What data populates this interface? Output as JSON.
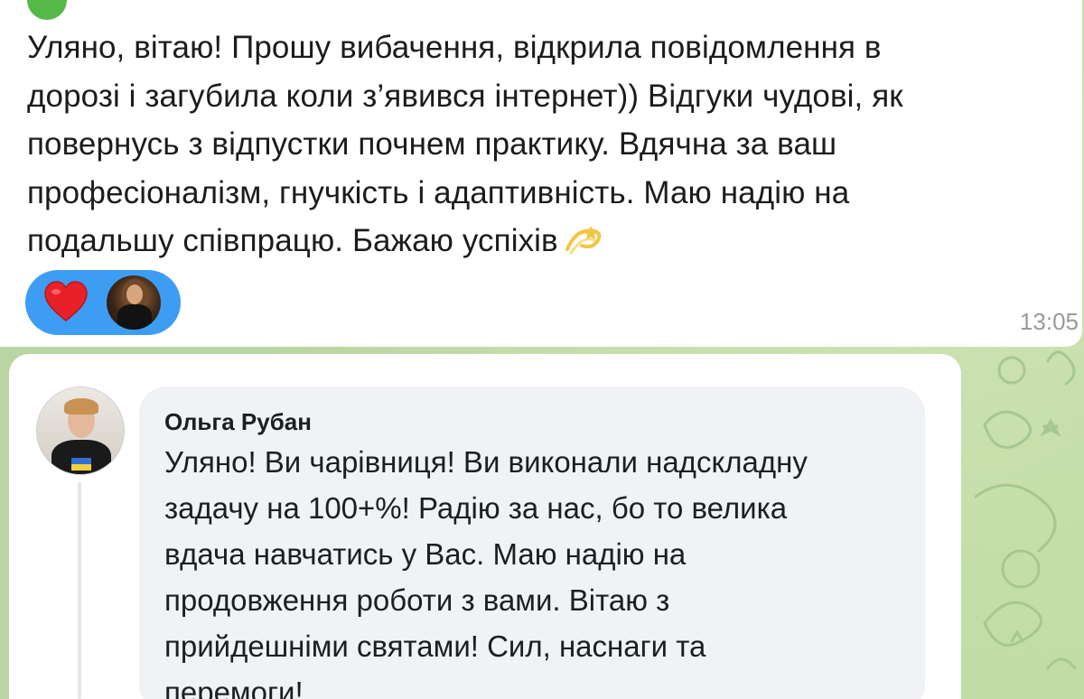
{
  "telegram_message": {
    "text": "Уляно, вітаю! Прошу вибачення, відкрила повідомлення в\nдорозі і загубила коли з’явився інтернет)) Відгуки чудові, як\nповернусь з відпустки почнем практику. Вдячна за ваш\nпрофесіоналізм, гнучкість і адаптивність. Маю надію на\nподальшу співпрацю. Бажаю успіхів",
    "emoji": "dizzy-icon",
    "reactions": [
      "heart-icon",
      "avatar"
    ],
    "time": "13:05"
  },
  "comment": {
    "author": "Ольга Рубан",
    "text": "Уляно! Ви чарівниця! Ви виконали надскладну\nзадачу на 100+%! Радію за нас, бо то велика\nвдача навчатись у Вас. Маю надію на\nпродовження роботи з вами. Вітаю з\nприйдешніми святами! Сил, наснаги та\nперемоги!"
  },
  "colors": {
    "reaction_pill": "#3d9df2",
    "wallpaper": "#b9d5a3",
    "comment_bg": "#f0f2f5",
    "time": "#9a9a9a"
  }
}
